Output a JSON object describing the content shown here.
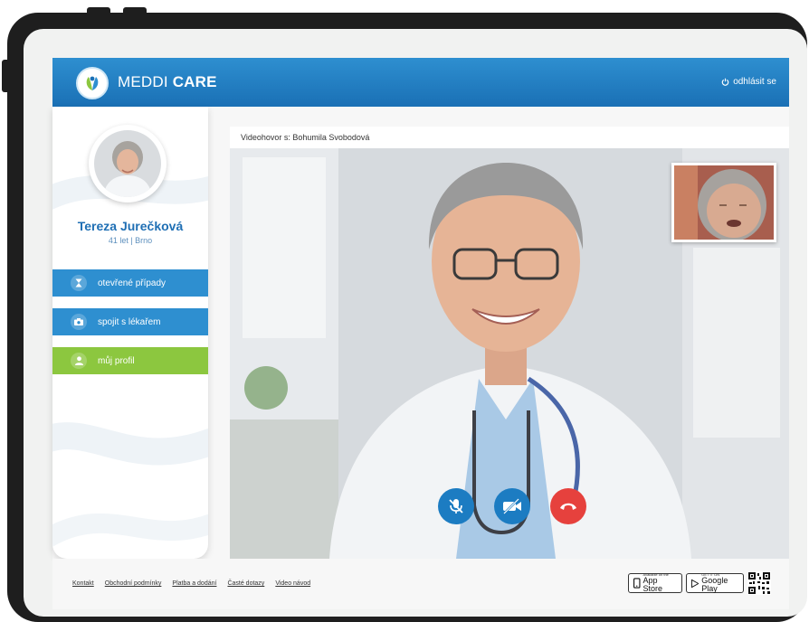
{
  "header": {
    "brand_light": "MEDDI ",
    "brand_bold": "CARE",
    "logout_label": "odhlásit se"
  },
  "profile": {
    "name": "Tereza Jurečková",
    "meta": "41 let | Brno"
  },
  "nav": [
    {
      "label": "otevřené případy",
      "icon": "hourglass-icon"
    },
    {
      "label": "spojit s lékařem",
      "icon": "camera-icon"
    },
    {
      "label": "můj profil",
      "icon": "user-icon"
    }
  ],
  "video": {
    "title": "Videohovor s: Bohumila Svobodová",
    "controls": [
      "mute-mic-icon",
      "camera-off-icon",
      "hang-up-icon"
    ]
  },
  "footer": {
    "links": [
      "Kontakt",
      "Obchodní podmínky",
      "Platba a dodání",
      "Časté dotazy",
      "Video návod"
    ],
    "app_store_small": "Available on the",
    "app_store_label": "App Store",
    "google_play_small": "GET IT ON",
    "google_play_label": "Google Play"
  },
  "colors": {
    "primary_blue": "#2e8fd0",
    "accent_green": "#8cc73f",
    "hangup_red": "#e6413d"
  }
}
